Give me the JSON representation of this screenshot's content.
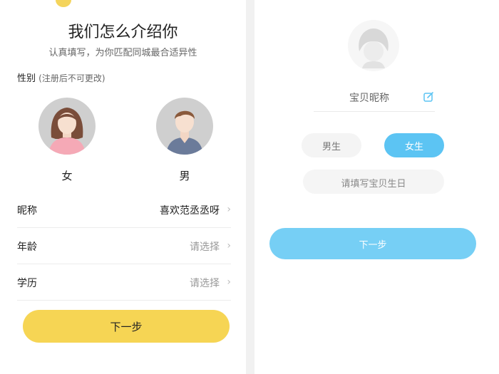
{
  "left": {
    "title": "我们怎么介绍你",
    "subtitle": "认真填写，为你匹配同城最合适异性",
    "gender_section": {
      "label": "性别",
      "note": "(注册后不可更改)"
    },
    "avatars": {
      "female": "女",
      "male": "男"
    },
    "rows": [
      {
        "label": "昵称",
        "value": "喜欢范丞丞呀",
        "chevron": "›"
      },
      {
        "label": "年龄",
        "value": "请选择",
        "chevron": "›"
      },
      {
        "label": "学历",
        "value": "请选择",
        "chevron": "›"
      }
    ],
    "next_label": "下一步",
    "colors": {
      "accent": "#f6d554"
    }
  },
  "right": {
    "nickname_placeholder": "宝贝昵称",
    "gender_options": {
      "boy": "男生",
      "girl": "女生",
      "selected": "女生"
    },
    "birthday_placeholder": "请填写宝贝生日",
    "next_label": "下一步",
    "colors": {
      "accent": "#5cc4f3"
    },
    "icons": {
      "edit": "edit-icon"
    }
  }
}
